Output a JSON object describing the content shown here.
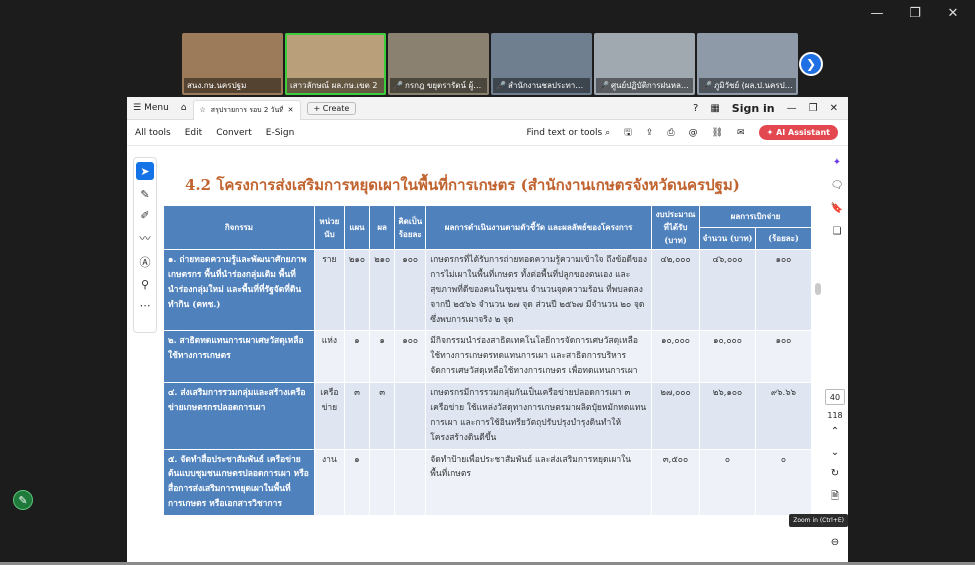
{
  "meeting": {
    "participants": [
      {
        "name": "สนง.กษ.นครปฐม",
        "muted": false,
        "active": false,
        "color": "#9b7b5a"
      },
      {
        "name": "เสาวลักษณ์ ผล.กษ.เขต 2",
        "muted": false,
        "active": true,
        "color": "#b9a07a"
      },
      {
        "name": "กรกฎ ขยุตรารัตน์ ผู้ตรวจร...",
        "muted": true,
        "active": false,
        "color": "#8a8170"
      },
      {
        "name": "สำนักงานชลประทานที่11",
        "muted": true,
        "active": false,
        "color": "#6f7f8f"
      },
      {
        "name": "ศูนย์ปฏิบัติการฝนหลวงภ...",
        "muted": true,
        "active": false,
        "color": "#a0a8b0"
      },
      {
        "name": "ภูมิวัชย์ (ผล.ป.นครปฐม)",
        "muted": true,
        "active": false,
        "color": "#8e9aa8"
      }
    ]
  },
  "acrobat": {
    "menu_label": "Menu",
    "tab_title": "สรุปรายการ รอบ 2 วันที่ 6 ตค...",
    "create_label": "Create",
    "sign_in": "Sign in",
    "toolbar": {
      "left": [
        "All tools",
        "Edit",
        "Convert",
        "E-Sign"
      ],
      "find_label": "Find text or tools",
      "ai_label": "AI Assistant"
    },
    "page_number": "40",
    "page_total": "118",
    "tooltip": "Zoom in (Ctrl+E)"
  },
  "document": {
    "title": "4.2 โครงการส่งเสริมการหยุดเผาในพื้นที่การเกษตร (สำนักงานเกษตรจังหวัดนครปฐม)",
    "headers": {
      "activity": "กิจกรรม",
      "unit": "หน่วยนับ",
      "plan": "แผน",
      "result": "ผล",
      "percent": "คิดเป็นร้อยละ",
      "outcome": "ผลการดำเนินงานตามตัวชี้วัด และผลลัพธ์ของโครงการ",
      "budget": "งบประมาณที่ได้รับ (บาท)",
      "spending": "ผลการเบิกจ่าย",
      "amount": "จำนวน (บาท)",
      "pct": "(ร้อยละ)"
    },
    "rows": [
      {
        "activity": "๑. ถ่ายทอดความรู้และพัฒนาศักยภาพเกษตรกร พื้นที่นำร่องกลุ่มเดิม พื้นที่นำร่องกลุ่มใหม่ และพื้นที่ที่รัฐจัดที่ดินทำกิน (คทช.)",
        "unit": "ราย",
        "plan": "๒๑๐",
        "result": "๒๑๐",
        "percent": "๑๐๐",
        "outcome": "เกษตรกรที่ได้รับการถ่ายทอดความรู้ความเข้าใจ ถึงข้อดีของการไม่เผาในพื้นที่เกษตร ทั้งต่อพื้นที่ปลูกของตนเอง และสุขภาพที่ดีของคนในชุมชน จำนวนจุดความร้อน ที่พบลดลง จากปี ๒๕๖๖ จำนวน ๒๗ จุด ส่วนปี ๒๕๖๗ มีจำนวน ๒๐ จุด ซึ่งพบการเผาจริง ๒ จุด",
        "budget": "๔๒,๐๐๐",
        "amount": "๔๖,๐๐๐",
        "pct": "๑๐๐"
      },
      {
        "activity": "๒. สาธิตทดแทนการเผาเศษวัสดุเหลือใช้ทางการเกษตร",
        "unit": "แห่ง",
        "plan": "๑",
        "result": "๑",
        "percent": "๑๐๐",
        "outcome": "มีกิจกรรมนำร่องสาธิตเทคโนโลยีการจัดการเศษวัสดุเหลือใช้ทางการเกษตรทดแทนการเผา และสาธิตการบริหารจัดการเศษวัสดุเหลือใช้ทางการเกษตร เพื่อทดแทนการเผา",
        "budget": "๑๐,๐๐๐",
        "amount": "๑๐,๐๐๐",
        "pct": "๑๐๐"
      },
      {
        "activity": "๔. ส่งเสริมการรวมกลุ่มและสร้างเครือข่ายเกษตรกรปลอดการเผา",
        "unit": "เครือข่าย",
        "plan": "๓",
        "result": "๓",
        "percent": "",
        "outcome": "เกษตรกรมีการรวมกลุ่มกันเป็นเครือข่ายปลอดการเผา ๓ เครือข่าย ใช้แหล่งวัสดุทางการเกษตรมาผลิตปุ๋ยหมักทดแทนการเผา และการใช้อินทรียวัตถุปรับปรุงบำรุงดินทำให้โครงสร้างดินดีขึ้น",
        "budget": "๒๗,๐๐๐",
        "amount": "๒๖,๑๐๐",
        "pct": "๙๖.๖๖"
      },
      {
        "activity": "๕. จัดทำสื่อประชาสัมพันธ์ เครือข่ายต้นแบบชุมชนเกษตรปลอดการเผา หรือสื่อการส่งเสริมการหยุดเผาในพื้นที่การเกษตร หรือเอกสารวิชาการ",
        "unit": "งาน",
        "plan": "๑",
        "result": "",
        "percent": "",
        "outcome": "จัดทำป้ายเพื่อประชาสัมพันธ์ และส่งเสริมการหยุดเผาในพื้นที่เกษตร",
        "budget": "๓,๕๐๐",
        "amount": "๐",
        "pct": "๐"
      }
    ]
  }
}
